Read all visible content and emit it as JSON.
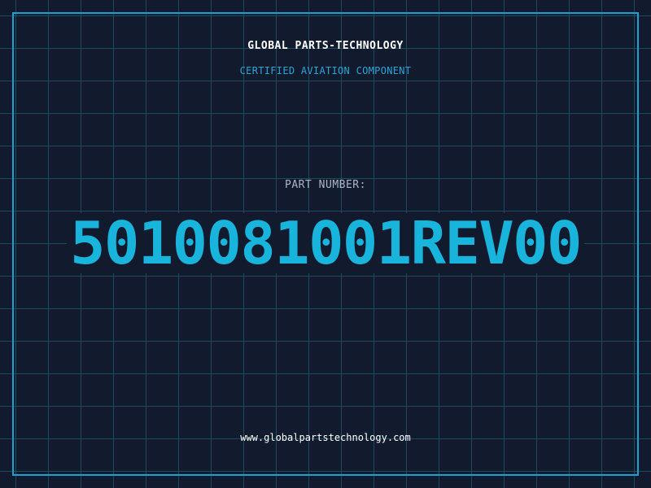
{
  "header": {
    "company": "GLOBAL PARTS-TECHNOLOGY",
    "subtitle": "CERTIFIED AVIATION COMPONENT"
  },
  "part": {
    "label": "PART NUMBER:",
    "number": "5010081001REV00"
  },
  "footer": {
    "website": "www.globalpartstechnology.com"
  },
  "colors": {
    "background": "#121b2e",
    "grid": "#1f4a5e",
    "accent": "#18b4dc",
    "frame": "#17a3cf",
    "text": "#ffffff",
    "muted": "#a9b6c8"
  }
}
